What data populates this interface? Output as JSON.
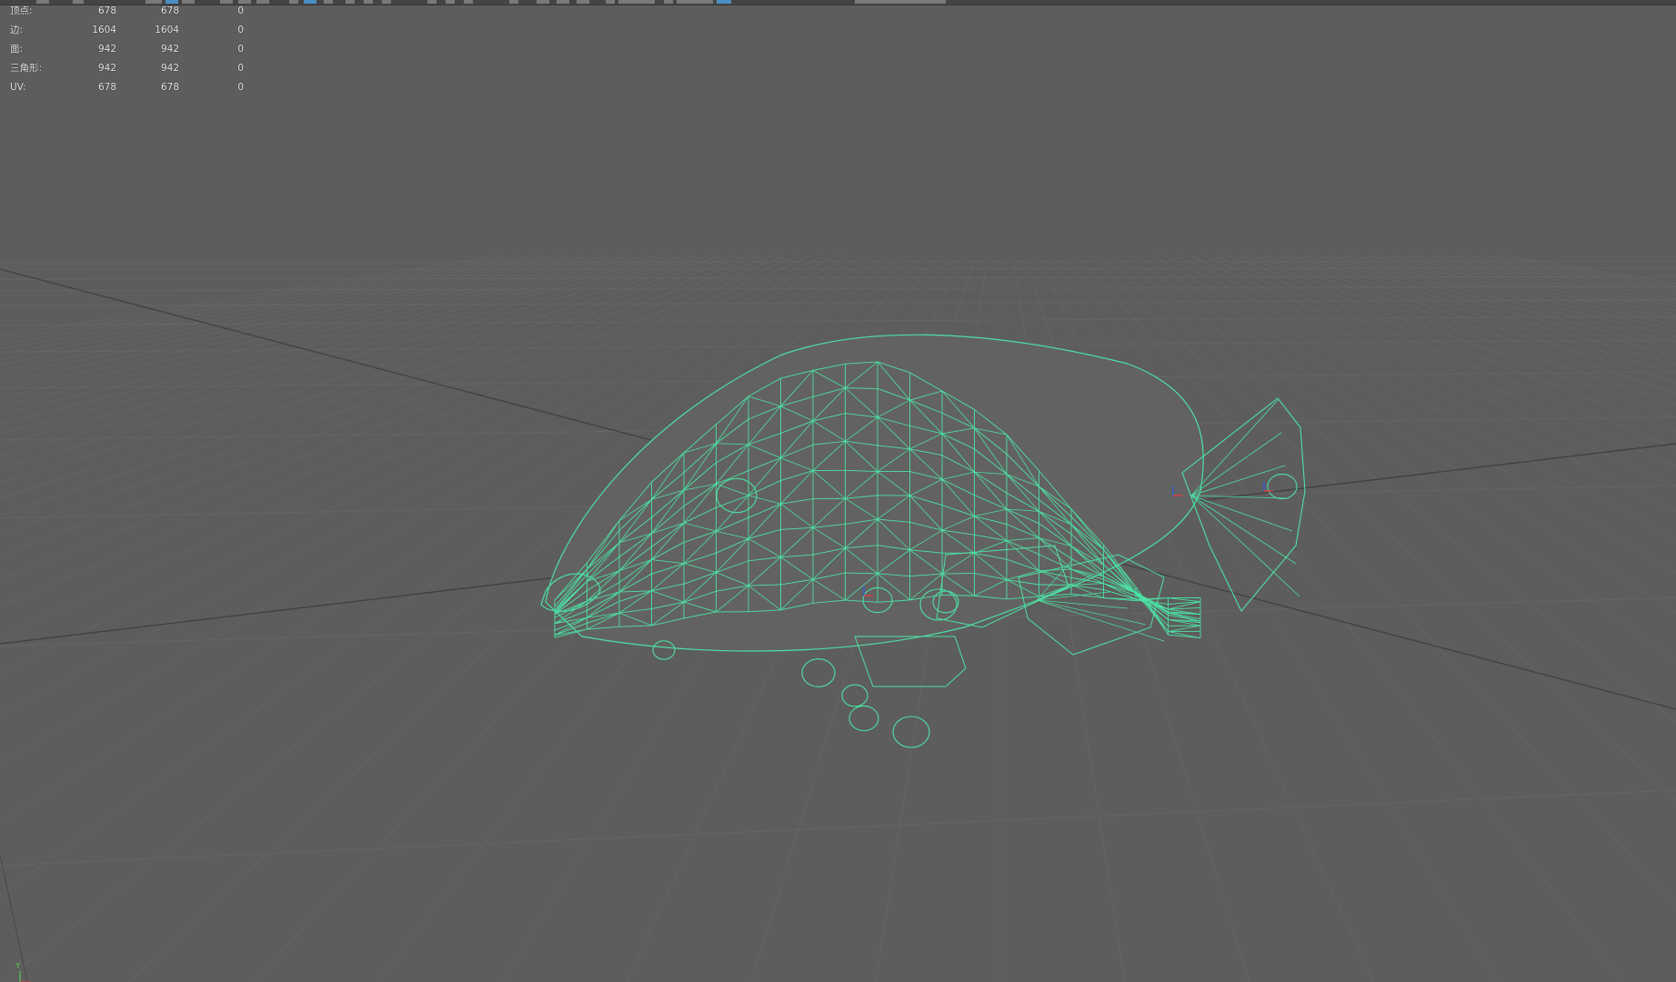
{
  "viewport": {
    "background": "#5d5d5d",
    "wire_color": "#4de0a4",
    "grid_color": "#6a6a6a",
    "grid_axis_color": "#3c3c3c"
  },
  "hud": {
    "rows": [
      {
        "label": "顶点:",
        "v1": "678",
        "v2": "678",
        "v3": "0"
      },
      {
        "label": "边:",
        "v1": "1604",
        "v2": "1604",
        "v3": "0"
      },
      {
        "label": "面:",
        "v1": "942",
        "v2": "942",
        "v3": "0"
      },
      {
        "label": "三角形:",
        "v1": "942",
        "v2": "942",
        "v3": "0"
      },
      {
        "label": "UV:",
        "v1": "678",
        "v2": "678",
        "v3": "0"
      }
    ]
  },
  "axis_gizmo": {
    "y_label": "Y"
  },
  "icons": {
    "toolbar": "toolbar-strip",
    "model": "fish-wireframe-model",
    "gizmo": "axis-orientation-gizmo"
  }
}
